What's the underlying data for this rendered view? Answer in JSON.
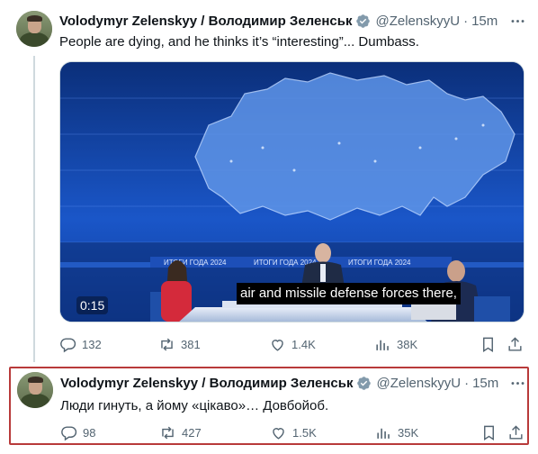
{
  "tweets": [
    {
      "author": "Volodymyr Zelenskyy / Володимир Зеленськ",
      "handle": "@ZelenskyyU",
      "separator": "·",
      "time": "15m",
      "text": "People are dying, and he thinks it’s “interesting”... Dumbass.",
      "video": {
        "subtitle": "air and missile defense forces there,",
        "duration": "0:15",
        "banner": "ИТОГИ ГОДА 2024"
      },
      "stats": {
        "replies": "132",
        "reposts": "381",
        "likes": "1.4K",
        "views": "38K"
      }
    },
    {
      "author": "Volodymyr Zelenskyy / Володимир Зеленськ",
      "handle": "@ZelenskyyU",
      "separator": "·",
      "time": "15m",
      "text": "Люди гинуть, а йому «цікаво»… Довбойоб.",
      "stats": {
        "replies": "98",
        "reposts": "427",
        "likes": "1.5K",
        "views": "35K"
      }
    }
  ],
  "colors": {
    "text": "#0f1419",
    "muted": "#536471",
    "verified": "#829aab",
    "highlight_border": "#b83a3a"
  },
  "icons": [
    "verified-badge-icon",
    "more-icon",
    "reply-icon",
    "repost-icon",
    "like-icon",
    "views-icon",
    "bookmark-icon",
    "share-icon"
  ]
}
